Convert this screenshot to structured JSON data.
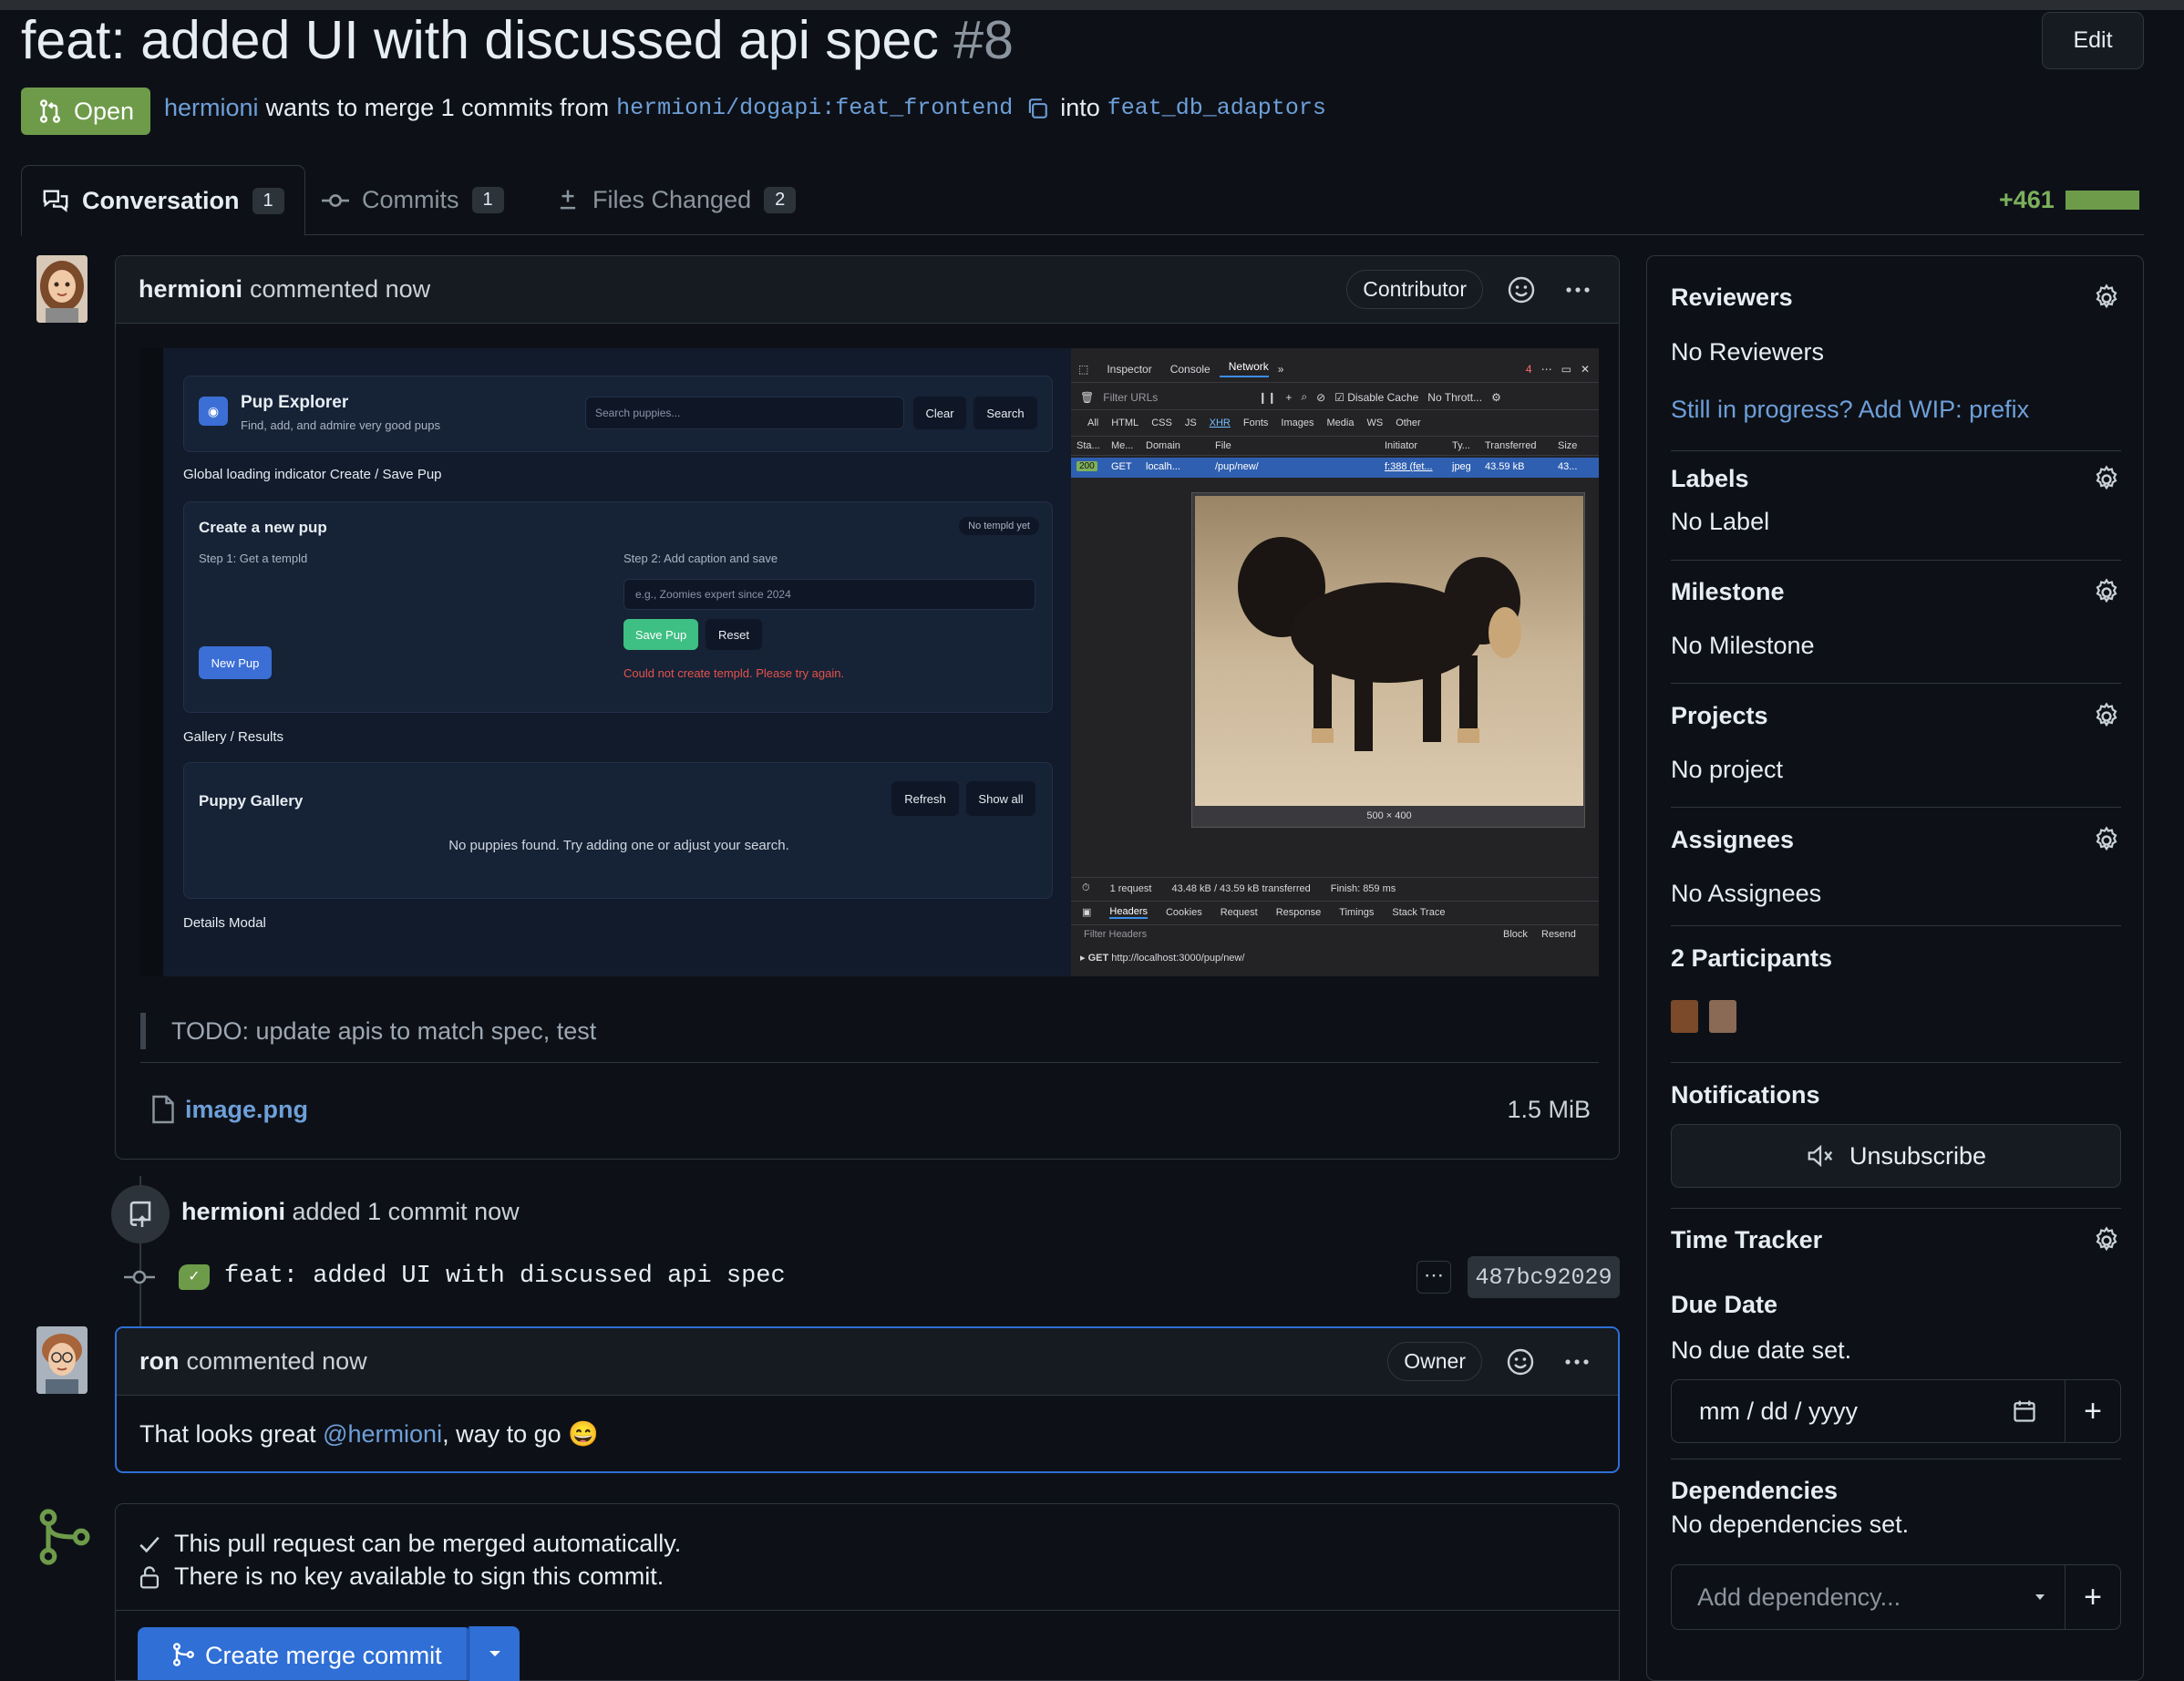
{
  "pr": {
    "title": "feat: added UI with discussed api spec",
    "number": "#8",
    "edit_label": "Edit",
    "status": "Open",
    "author": "hermioni",
    "merge_text_1": "wants to merge 1 commits from",
    "source_branch": "hermioni/dogapi:feat_frontend",
    "merge_text_2": "into",
    "target_branch": "feat_db_adaptors",
    "additions": "+461"
  },
  "tabs": [
    {
      "label": "Conversation",
      "count": "1"
    },
    {
      "label": "Commits",
      "count": "1"
    },
    {
      "label": "Files Changed",
      "count": "2"
    }
  ],
  "comment1": {
    "author": "hermioni",
    "action": "commented now",
    "role": "Contributor",
    "quote": "TODO: update apis to match spec, test",
    "attachment_name": "image.png",
    "attachment_size": "1.5 MiB"
  },
  "screenshot": {
    "app_title": "Pup Explorer",
    "app_subtitle": "Find, add, and admire very good pups",
    "search_placeholder": "Search puppies...",
    "clear": "Clear",
    "search": "Search",
    "section1": "Global loading indicator Create / Save Pup",
    "create_title": "Create a new pup",
    "no_templd": "No templd yet",
    "step1": "Step 1: Get a templd",
    "step2": "Step 2: Add caption and save",
    "caption_placeholder": "e.g., Zoomies expert since 2024",
    "save_pup": "Save Pup",
    "reset": "Reset",
    "new_pup": "New Pup",
    "error": "Could not create templd. Please try again.",
    "section2": "Gallery / Results",
    "gallery_title": "Puppy Gallery",
    "refresh": "Refresh",
    "show_all": "Show all",
    "empty": "No puppies found. Try adding one or adjust your search.",
    "section3": "Details Modal",
    "devtools": {
      "tabs": [
        "Inspector",
        "Console",
        "Network"
      ],
      "errors": "4",
      "filter": "Filter URLs",
      "disable_cache": "Disable Cache",
      "throttle": "No Thrott...",
      "types": [
        "All",
        "HTML",
        "CSS",
        "JS",
        "XHR",
        "Fonts",
        "Images",
        "Media",
        "WS",
        "Other"
      ],
      "columns": [
        "Sta...",
        "Me...",
        "Domain",
        "File",
        "Initiator",
        "Ty...",
        "Transferred",
        "Size"
      ],
      "row": [
        "200",
        "GET",
        "localh...",
        "/pup/new/",
        "f:388 (fet...",
        "jpeg",
        "43.59 kB",
        "43..."
      ],
      "image_dims": "500 × 400",
      "summary": [
        "1 request",
        "43.48 kB / 43.59 kB transferred",
        "Finish: 859 ms"
      ],
      "detail_tabs": [
        "Headers",
        "Cookies",
        "Request",
        "Response",
        "Timings",
        "Stack Trace"
      ],
      "filter_headers": "Filter Headers",
      "block": "Block",
      "resend": "Resend",
      "request_line": "GET",
      "request_url": "http://localhost:3000/pup/new/"
    }
  },
  "commit_event": {
    "author": "hermioni",
    "action": "added 1 commit now",
    "message": "feat: added UI with discussed api spec",
    "sha": "487bc92029"
  },
  "comment2": {
    "author": "ron",
    "action": "commented now",
    "role": "Owner",
    "text_before": "That looks great ",
    "mention": "@hermioni",
    "text_after": ", way to go 😄"
  },
  "merge_box": {
    "line1": "This pull request can be merged automatically.",
    "line2": "There is no key available to sign this commit.",
    "button": "Create merge commit"
  },
  "sidebar": {
    "reviewers_title": "Reviewers",
    "reviewers_value": "No Reviewers",
    "wip_link": "Still in progress? Add WIP: prefix",
    "labels_title": "Labels",
    "labels_value": "No Label",
    "milestone_title": "Milestone",
    "milestone_value": "No Milestone",
    "projects_title": "Projects",
    "projects_value": "No project",
    "assignees_title": "Assignees",
    "assignees_value": "No Assignees",
    "participants_title": "2 Participants",
    "notifications_title": "Notifications",
    "unsubscribe": "Unsubscribe",
    "time_tracker_title": "Time Tracker",
    "due_date_title": "Due Date",
    "due_date_value": "No due date set.",
    "date_placeholder": "mm / dd / yyyy",
    "dependencies_title": "Dependencies",
    "dependencies_value": "No dependencies set.",
    "dependency_placeholder": "Add dependency..."
  },
  "colors": {
    "accent_link": "#6e9fd9",
    "open_badge": "#6e9b4a",
    "merge_button": "#2f6fd6",
    "border": "#30363d"
  }
}
